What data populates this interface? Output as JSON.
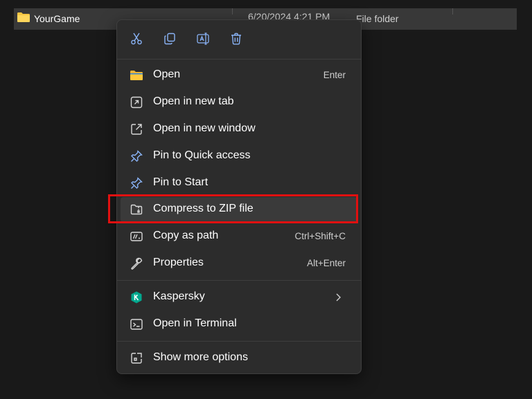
{
  "explorer": {
    "file_name": "YourGame",
    "file_date": "6/20/2024 4:21 PM",
    "file_type": "File folder"
  },
  "quick_actions": [
    {
      "icon": "cut-icon"
    },
    {
      "icon": "copy-icon"
    },
    {
      "icon": "rename-icon"
    },
    {
      "icon": "delete-icon"
    }
  ],
  "menu": {
    "items": [
      {
        "label": "Open",
        "accel": "Enter",
        "icon": "folder-icon"
      },
      {
        "label": "Open in new tab",
        "accel": "",
        "icon": "new-tab-icon"
      },
      {
        "label": "Open in new window",
        "accel": "",
        "icon": "new-window-icon"
      },
      {
        "label": "Pin to Quick access",
        "accel": "",
        "icon": "pin-icon"
      },
      {
        "label": "Pin to Start",
        "accel": "",
        "icon": "pin-icon"
      },
      {
        "label": "Compress to ZIP file",
        "accel": "",
        "icon": "zip-icon"
      },
      {
        "label": "Copy as path",
        "accel": "Ctrl+Shift+C",
        "icon": "copy-path-icon"
      },
      {
        "label": "Properties",
        "accel": "Alt+Enter",
        "icon": "wrench-icon"
      },
      {
        "label": "Kaspersky",
        "accel": "",
        "icon": "kaspersky-icon"
      },
      {
        "label": "Open in Terminal",
        "accel": "",
        "icon": "terminal-icon"
      },
      {
        "label": "Show more options",
        "accel": "",
        "icon": "more-options-icon"
      }
    ]
  },
  "colors": {
    "highlight": "#e01010",
    "accent_blue": "#8ab4f8",
    "kaspersky_green": "#00a88e"
  }
}
